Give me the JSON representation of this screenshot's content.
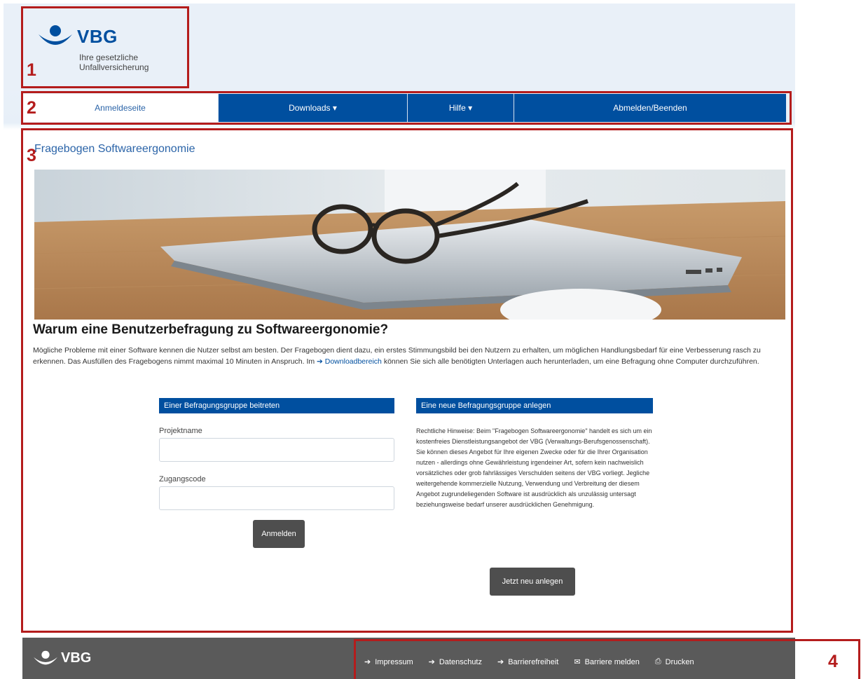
{
  "logo": {
    "brand": "VBG",
    "tagline_line1": "Ihre gesetzliche",
    "tagline_line2": "Unfallversicherung"
  },
  "nav": {
    "items": [
      {
        "label": "Anmeldeseite",
        "active": true
      },
      {
        "label": "Downloads ▾",
        "active": false
      },
      {
        "label": "Hilfe ▾",
        "active": false
      },
      {
        "label": "Abmelden/Beenden",
        "active": false
      }
    ]
  },
  "main": {
    "page_title": "Fragebogen Softwareergonomie",
    "intro_heading": "Warum eine Benutzerbefragung zu Softwareergonomie?",
    "intro_text_before": "Mögliche Probleme mit einer Software kennen die Nutzer selbst am besten. Der Fragebogen dient dazu, ein erstes Stimmungsbild bei den Nutzern zu erhalten, um möglichen Handlungsbedarf für eine Verbesserung rasch zu erkennen. Das Ausfüllen des Fragebogens nimmt maximal 10 Minuten in Anspruch. Im ",
    "intro_link": "➔ Downloadbereich",
    "intro_text_after": " können Sie sich alle benötigten Unterlagen auch herunterladen, um eine Befragung ohne Computer durchzuführen."
  },
  "join_panel": {
    "heading": "Einer Befragungsgruppe beitreten",
    "project_label": "Projektname",
    "project_value": "",
    "code_label": "Zugangscode",
    "code_value": "",
    "submit_label": "Anmelden"
  },
  "create_panel": {
    "heading": "Eine neue Befragungsgruppe anlegen",
    "legal_text": "Rechtliche Hinweise: Beim \"Fragebogen Softwareergonomie\" handelt es sich um ein kostenfreies Dienstleistungsangebot der VBG (Verwaltungs-Berufsgenossenschaft). Sie können dieses Angebot für Ihre eigenen Zwecke oder für die Ihrer Organisation nutzen - allerdings ohne Gewährleistung irgendeiner Art, sofern kein nachweislich vorsätzliches oder grob fahrlässiges Verschulden seitens der VBG vorliegt. Jegliche weitergehende kommerzielle Nutzung, Verwendung und Verbreitung der diesem Angebot zugrundeliegenden Software ist ausdrücklich als unzulässig untersagt beziehungsweise bedarf unserer ausdrücklichen Genehmigung.",
    "create_label": "Jetzt neu anlegen"
  },
  "footer": {
    "brand": "VBG",
    "links": [
      {
        "icon": "arrow-right-icon",
        "glyph": "➔",
        "label": "Impressum"
      },
      {
        "icon": "arrow-right-icon",
        "glyph": "➔",
        "label": "Datenschutz"
      },
      {
        "icon": "arrow-right-icon",
        "glyph": "➔",
        "label": "Barrierefreiheit"
      },
      {
        "icon": "envelope-icon",
        "glyph": "✉",
        "label": "Barriere melden"
      },
      {
        "icon": "printer-icon",
        "glyph": "⎙",
        "label": "Drucken"
      }
    ]
  },
  "callouts": [
    "1",
    "2",
    "3",
    "4"
  ],
  "colors": {
    "brand_blue": "#004f9f",
    "link_blue": "#2b64a8",
    "callout_red": "#b41c1c",
    "footer_gray": "#5a5a5a",
    "button_gray": "#4e4e4e"
  }
}
